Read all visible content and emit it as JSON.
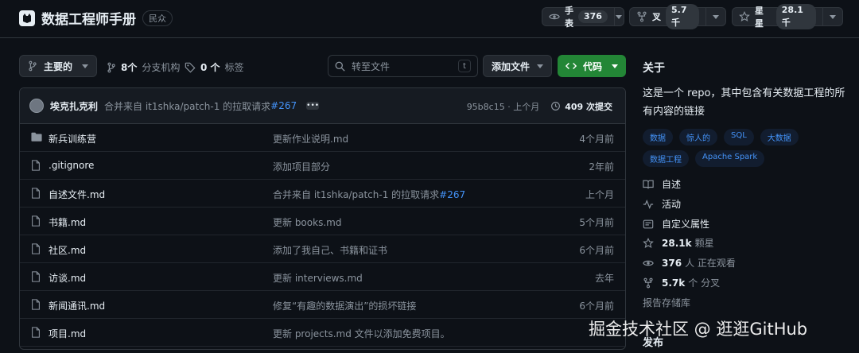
{
  "repo": {
    "name": "数据工程师手册",
    "visibility": "民众"
  },
  "header_buttons": {
    "watch": {
      "label": "手表",
      "count": "376"
    },
    "fork": {
      "label": "叉",
      "count": "5.7千"
    },
    "star": {
      "label": "星星",
      "count": "28.1千"
    }
  },
  "toolbar": {
    "branch": "主要的",
    "branches_count": "8个",
    "branches_label": "分支机构",
    "tags_count": "0 个",
    "tags_label": "标签",
    "search_placeholder": "转至文件",
    "search_shortcut": "t",
    "add_file": "添加文件",
    "code": "代码"
  },
  "latest_commit": {
    "author": "埃克扎克利",
    "message": "合并来自 it1shka/patch-1 的拉取请求",
    "pr": "#267",
    "hash_time": "95b8c15 · 上个月",
    "commits": "409 次提交"
  },
  "files": [
    {
      "type": "folder",
      "name": "新兵训练营",
      "message": "更新作业说明.md",
      "pr": "",
      "date": "4个月前"
    },
    {
      "type": "file",
      "name": ".gitignore",
      "message": "添加项目部分",
      "pr": "",
      "date": "2年前"
    },
    {
      "type": "file",
      "name": "自述文件.md",
      "message": "合并来自 it1shka/patch-1 的拉取请求",
      "pr": "#267",
      "date": "上个月"
    },
    {
      "type": "file",
      "name": "书籍.md",
      "message": "更新 books.md",
      "pr": "",
      "date": "5个月前"
    },
    {
      "type": "file",
      "name": "社区.md",
      "message": "添加了我自己、书籍和证书",
      "pr": "",
      "date": "6个月前"
    },
    {
      "type": "file",
      "name": "访谈.md",
      "message": "更新 interviews.md",
      "pr": "",
      "date": "去年"
    },
    {
      "type": "file",
      "name": "新闻通讯.md",
      "message": "修复“有趣的数据演出”的损坏链接",
      "pr": "",
      "date": "6个月前"
    },
    {
      "type": "file",
      "name": "项目.md",
      "message": "更新 projects.md 文件以添加免费项目。",
      "pr": "",
      "date": ""
    }
  ],
  "about": {
    "title": "关于",
    "description": "这是一个 repo，其中包含有关数据工程的所有内容的链接",
    "topics": [
      "数据",
      "惊人的",
      "SQL",
      "大数据",
      "数据工程",
      "Apache Spark"
    ],
    "readme": "自述",
    "activity": "活动",
    "custom_properties": "自定义属性",
    "stars_value": "28.1k",
    "stars_label": "颗星",
    "watching_value": "376",
    "watching_label": "人 正在观看",
    "forks_value": "5.7k",
    "forks_label": "个 分叉",
    "report": "报告存储库",
    "publish": "发布"
  },
  "watermark": "掘金技术社区 @ 逛逛GitHub",
  "colors": {
    "background": "#0d1117",
    "border": "#30363d",
    "accent_blue": "#4493f8",
    "code_button": "#238636"
  }
}
